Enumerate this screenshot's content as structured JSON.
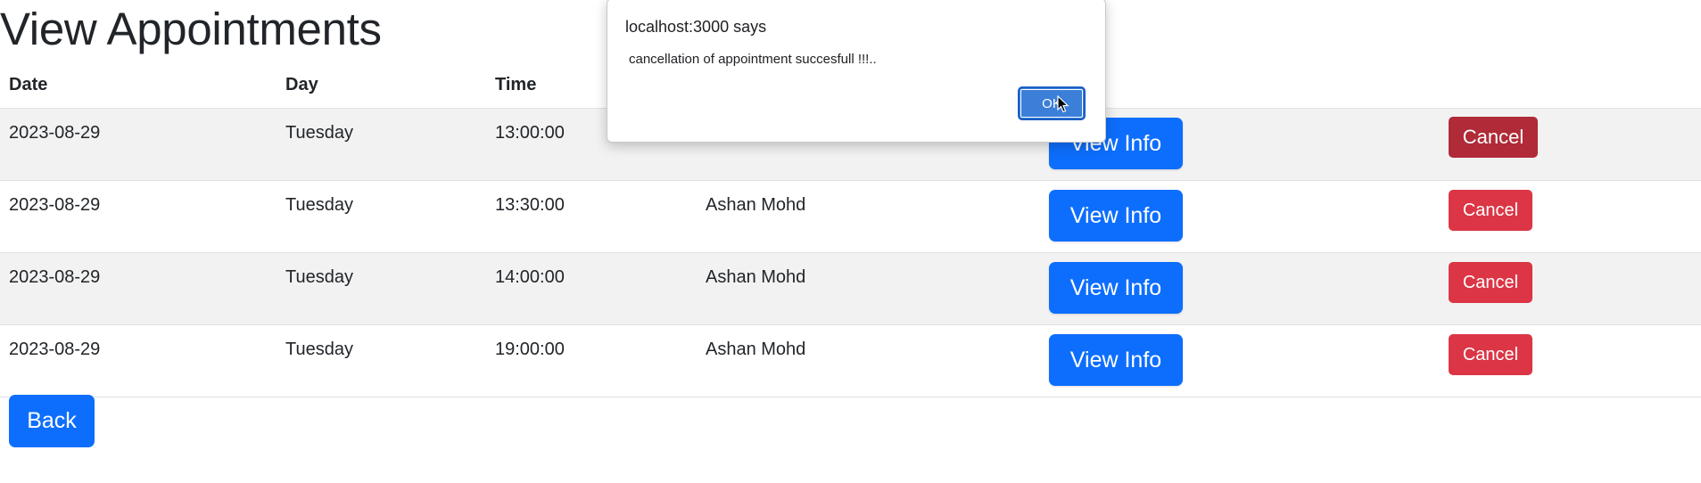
{
  "page": {
    "title": "View Appointments"
  },
  "table": {
    "headers": [
      "Date",
      "Day",
      "Time"
    ],
    "rows": [
      {
        "date": "2023-08-29",
        "day": "Tuesday",
        "time": "13:00:00",
        "name": "",
        "view_label": "View Info",
        "cancel_label": "Cancel"
      },
      {
        "date": "2023-08-29",
        "day": "Tuesday",
        "time": "13:30:00",
        "name": "Ashan Mohd",
        "view_label": "View Info",
        "cancel_label": "Cancel"
      },
      {
        "date": "2023-08-29",
        "day": "Tuesday",
        "time": "14:00:00",
        "name": "Ashan Mohd",
        "view_label": "View Info",
        "cancel_label": "Cancel"
      },
      {
        "date": "2023-08-29",
        "day": "Tuesday",
        "time": "19:00:00",
        "name": "Ashan Mohd",
        "view_label": "View Info",
        "cancel_label": "Cancel"
      }
    ]
  },
  "back_label": "Back",
  "dialog": {
    "title": "localhost:3000 says",
    "message": "cancellation of appointment succesfull !!!..",
    "ok_label": "OK"
  },
  "colors": {
    "primary": "#0d6efd",
    "danger": "#dc3545",
    "danger_active": "#b02a37",
    "stripe": "#f2f2f2"
  },
  "icons": {
    "cursor": "mouse-pointer-icon"
  }
}
